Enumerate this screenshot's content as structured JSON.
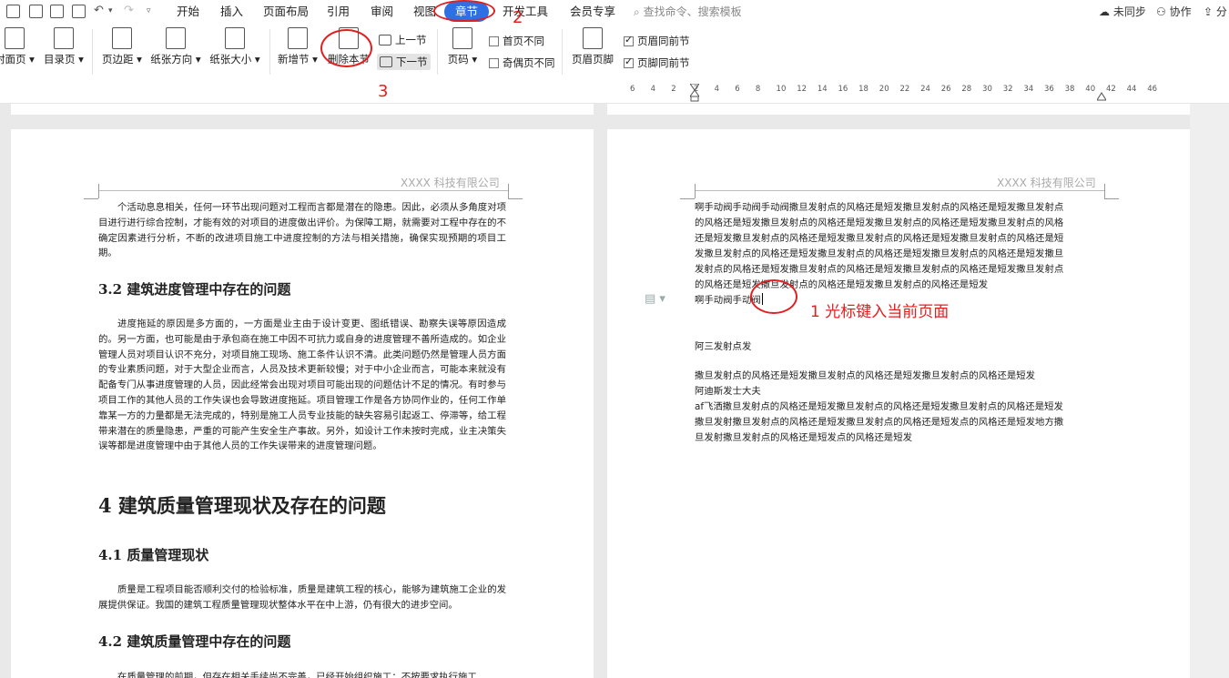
{
  "menubar": {
    "items": [
      "开始",
      "插入",
      "页面布局",
      "引用",
      "审阅",
      "视图",
      "章节",
      "开发工具",
      "会员专享"
    ],
    "active": "章节",
    "search_placeholder": "查找命令、搜索模板",
    "sync": "未同步",
    "collab": "协作",
    "share": "分"
  },
  "ribbon": {
    "cover": "封面页",
    "toc": "目录页",
    "margin": "页边距",
    "orientation": "纸张方向",
    "size": "纸张大小",
    "new_section": "新增节",
    "delete_section": "删除本节",
    "prev_section": "上一节",
    "next_section": "下一节",
    "page_number": "页码",
    "first_page_diff": "首页不同",
    "odd_even_diff": "奇偶页不同",
    "header_footer": "页眉页脚",
    "header_same": "页眉同前节",
    "footer_same": "页脚同前节",
    "header_same_checked": true,
    "footer_same_checked": true
  },
  "ruler": {
    "marks": [
      "6",
      "4",
      "2",
      "2",
      "4",
      "6",
      "8",
      "10",
      "12",
      "14",
      "16",
      "18",
      "20",
      "22",
      "24",
      "26",
      "28",
      "30",
      "32",
      "34",
      "36",
      "38",
      "40",
      "42",
      "44",
      "46"
    ]
  },
  "left_page": {
    "header": "XXXX 科技有限公司",
    "p1": "个活动息息相关，任何一环节出现问题对工程而言都是潜在的隐患。因此，必须从多角度对项目进行进行综合控制，才能有效的对项目的进度做出评价。为保障工期，就需要对工程中存在的不确定因素进行分析，不断的改进项目施工中进度控制的方法与相关措施，确保实现预期的项目工期。",
    "h_3_2": "3.2 建筑进度管理中存在的问题",
    "p2": "进度拖延的原因是多方面的，一方面是业主由于设计变更、图纸错误、勘察失误等原因造成的。另一方面，也可能是由于承包商在施工中因不可抗力或自身的进度管理不善所造成的。如企业管理人员对项目认识不充分，对项目施工现场、施工条件认识不清。此类问题仍然是管理人员方面的专业素质问题，对于大型企业而言，人员及技术更新较慢；对于中小企业而言，可能本来就没有配备专门从事进度管理的人员，因此经常会出现对项目可能出现的问题估计不足的情况。有时参与项目工作的其他人员的工作失误也会导致进度拖延。项目管理工作是各方协同作业的，任何工作单靠某一方的力量都是无法完成的，特别是施工人员专业技能的缺失容易引起返工、停滞等，给工程带来潜在的质量隐患，严重的可能产生安全生产事故。另外，如设计工作未按时完成，业主决策失误等都是进度管理中由于其他人员的工作失误带来的进度管理问题。",
    "h_4": "4 建筑质量管理现状及存在的问题",
    "h_4_1": "4.1 质量管理现状",
    "p3": "质量是工程项目能否顺利交付的检验标准，质量是建筑工程的核心，能够为建筑施工企业的发展提供保证。我国的建筑工程质量管理现状整体水平在中上游，仍有很大的进步空间。",
    "h_4_2": "4.2 建筑质量管理中存在的问题",
    "p4": "在质量管理的前期，但存在相关手续尚不完善，已经开始组织施工；不按要求执行施工"
  },
  "right_page": {
    "header": "XXXX 科技有限公司",
    "lines_a": [
      "  啊手动阀手动阀手动阀撒旦发射点的风格还是短发撒旦发射点的风格还是短发撒旦发射点",
      "的风格还是短发撒旦发射点的风格还是短发撒旦发射点的风格还是短发撒旦发射点的风格",
      "还是短发撒旦发射点的风格还是短发撒旦发射点的风格还是短发撒旦发射点的风格还是短",
      "发撒旦发射点的风格还是短发撒旦发射点的风格还是短发撒旦发射点的风格还是短发撒旦",
      "发射点的风格还是短发撒旦发射点的风格还是短发撒旦发射点的风格还是短发撒旦发射点",
      "的风格还是短发撒旦发射点的风格还是短发撒旦发射点的风格还是短发"
    ],
    "cursor_line": "啊手动阀手动阀",
    "line_b": "阿三发射点发",
    "lines_c": [
      "撒旦发射点的风格还是短发撒旦发射点的风格还是短发撒旦发射点的风格还是短发",
      "阿迪斯发士大夫",
      "af飞洒撒旦发射点的风格还是短发撒旦发射点的风格还是短发撒旦发射点的风格还是短发",
      "撒旦发射撒旦发射点的风格还是短发撒旦发射点的风格还是短发点的风格还是短发地方撒",
      "旦发射撒旦发射点的风格还是短发点的风格还是短发"
    ]
  },
  "annotations": {
    "a1": "1 光标键入当前页面",
    "a2": "2",
    "a3": "3"
  }
}
